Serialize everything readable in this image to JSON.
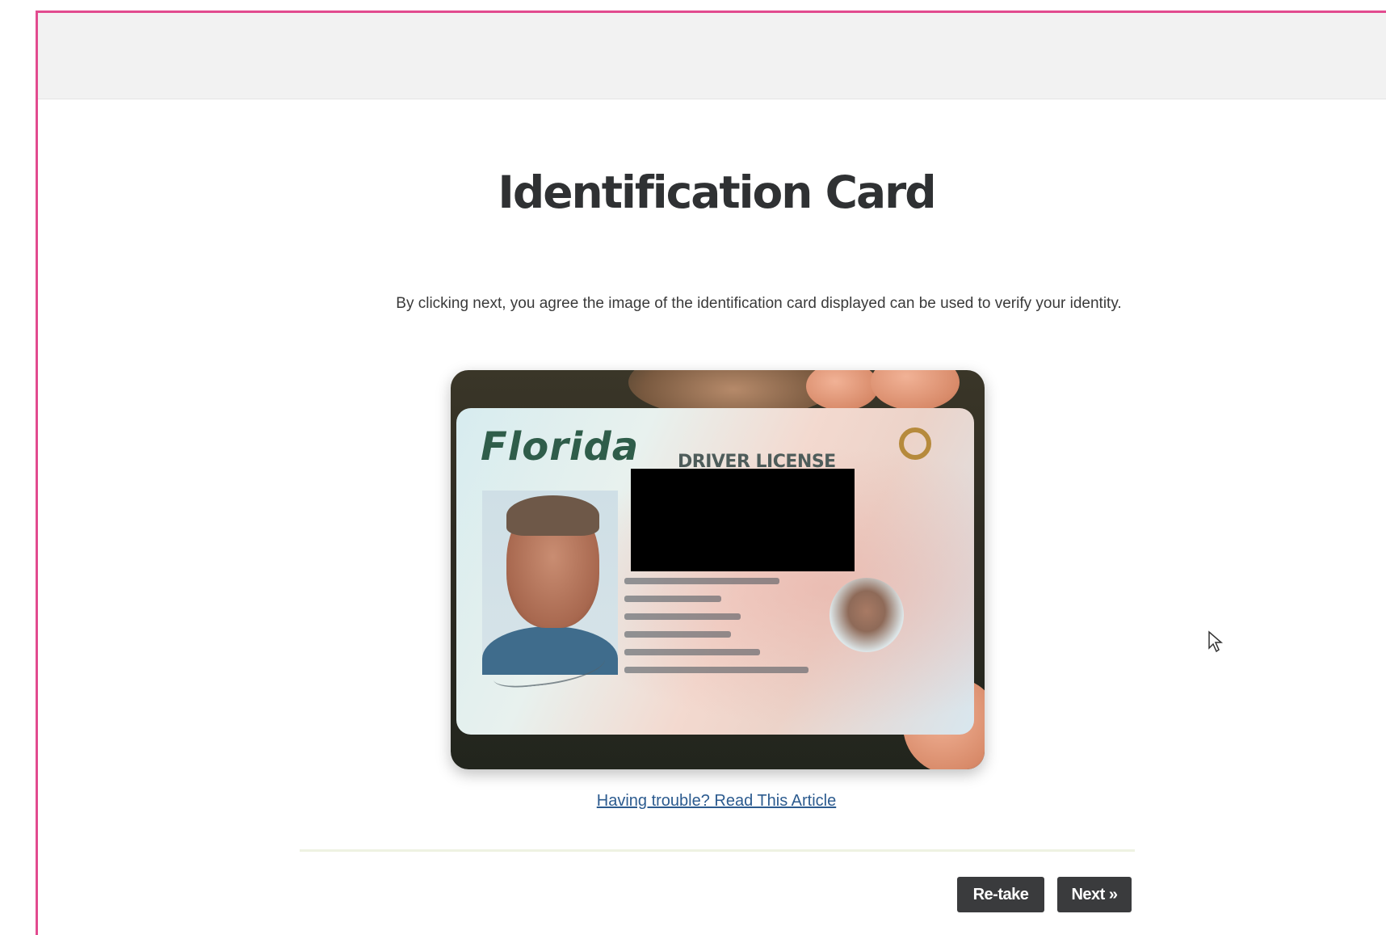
{
  "page": {
    "title": "Identification Card",
    "instructions": "By clicking next, you agree the image of the identification card displayed can be used to verify your identity."
  },
  "photo": {
    "card_state": "Florida",
    "card_type": "DRIVER LICENSE"
  },
  "help": {
    "link_text": "Having trouble? Read This Article"
  },
  "actions": {
    "retake_label": "Re-take",
    "next_label": "Next »"
  },
  "colors": {
    "frame_border": "#e24b8f",
    "button_bg": "#3a3b3d",
    "link": "#2c5b8f"
  }
}
